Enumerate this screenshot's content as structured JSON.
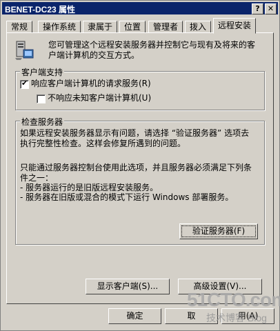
{
  "window": {
    "title": "BENET-DC23 属性",
    "help_glyph": "?",
    "close_glyph": "✕"
  },
  "tabs": [
    {
      "label": "常规"
    },
    {
      "label": "操作系统"
    },
    {
      "label": "隶属于"
    },
    {
      "label": "位置"
    },
    {
      "label": "管理者"
    },
    {
      "label": "拨入"
    },
    {
      "label": "远程安装"
    }
  ],
  "intro": {
    "icon": "server-icon",
    "text_line1": "您可管理这个远程安装服务器并控制它与现有及将来的客",
    "text_line2": "户端计算机的交互方式。"
  },
  "client_support": {
    "legend": "客户端支持",
    "respond": {
      "label": "响应客户端计算机的请求服务(R)",
      "checked": true
    },
    "no_unknown": {
      "label": "不响应未知客户端计算机(U)",
      "checked": false
    }
  },
  "check_server": {
    "legend": "检查服务器",
    "line1": "如果远程安装服务器显示有问题，请选择 “验证服务器” 选项去",
    "line2": "执行完整性检查。这样会修复所遇到的问题。",
    "line3": "只能通过服务器控制台使用此选项，并且服务器必须满足下列条",
    "line4": "件之一：",
    "line5": "- 服务器运行的是旧版远程安装服务。",
    "line6": "- 服务器在旧版或混合的模式下运行 Windows 部署服务。",
    "verify_button": "验证服务器(F)"
  },
  "bottom_buttons": {
    "show_clients": "显示客户端(S)...",
    "advanced": "高级设置(V)..."
  },
  "dialog_buttons": {
    "ok": "确定",
    "cancel": "取",
    "apply": "用(A)"
  },
  "watermark": {
    "big": "51CTO.com",
    "small": "技术博客 Blog"
  }
}
